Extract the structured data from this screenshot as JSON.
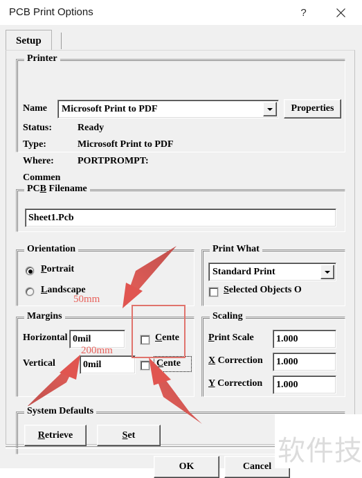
{
  "window": {
    "title": "PCB Print Options",
    "help_button": "?",
    "close_button": "×"
  },
  "tabs": [
    {
      "label": "Setup",
      "selected": true
    }
  ],
  "printer": {
    "group_title": "Printer",
    "name_label": "Name",
    "name_value": "Microsoft Print to PDF",
    "properties_button": "Properties",
    "status_label": "Status:",
    "status_value": "Ready",
    "type_label": "Type:",
    "type_value": "Microsoft Print to PDF",
    "where_label": "Where:",
    "where_value": "PORTPROMPT:",
    "comment_label": "Commen"
  },
  "pcb_filename": {
    "group_title": "PCB Filename",
    "group_title_pre": "PC",
    "group_title_accel": "B",
    "group_title_post": " Filename",
    "value": "Sheet1.Pcb"
  },
  "orientation": {
    "group_title": "Orientation",
    "options": [
      {
        "label": "Portrait",
        "accel": "P",
        "rest": "ortrait",
        "selected": true
      },
      {
        "label": "Landscape",
        "accel": "L",
        "rest": "andscape",
        "selected": false
      }
    ]
  },
  "print_what": {
    "group_title": "Print What",
    "selected_value": "Standard Print",
    "checkbox_label": "Selected Objects O",
    "checkbox_accel": "S",
    "checkbox_rest": "elected Objects O",
    "checkbox_checked": false
  },
  "margins": {
    "group_title": "Margins",
    "horizontal_label": "Horizontal",
    "horizontal_value": "0mil",
    "horizontal_center_label": "Cente",
    "horizontal_center_accel": "C",
    "horizontal_center_rest": "ente",
    "horizontal_center_checked": false,
    "vertical_label": "Vertical",
    "vertical_value": "0mil",
    "vertical_center_label": "Cente",
    "vertical_center_accel": "C",
    "vertical_center_rest": "ente",
    "vertical_center_checked": false
  },
  "scaling": {
    "group_title": "Scaling",
    "print_scale_label": "Print Scale",
    "print_scale_accel": "P",
    "print_scale_rest": "rint Scale",
    "print_scale_value": "1.000",
    "x_correction_label": "X Correction",
    "x_correction_accel": "X",
    "x_correction_rest": " Correction",
    "x_correction_value": "1.000",
    "y_correction_label": "Y Correction",
    "y_correction_accel": "Y",
    "y_correction_rest": " Correction",
    "y_correction_value": "1.000"
  },
  "system_defaults": {
    "group_title": "System Defaults",
    "retrieve_button": "Retrieve",
    "retrieve_accel": "R",
    "retrieve_rest": "etrieve",
    "set_button": "Set",
    "set_accel": "S",
    "set_rest": "et"
  },
  "footer": {
    "ok_button": "OK",
    "cancel_button": "Cancel"
  },
  "annotations": {
    "color": "#e8625c",
    "margin_top_note": "50mm",
    "margin_bottom_note": "200mm",
    "highlight_box": "center-checkbox-group"
  },
  "watermark": {
    "text": "软件技巧"
  }
}
